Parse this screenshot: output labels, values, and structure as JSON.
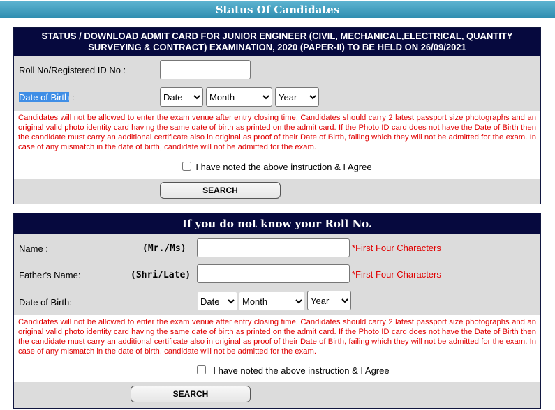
{
  "page_title": "Status Of Candidates",
  "section1": {
    "title": "STATUS / DOWNLOAD ADMIT CARD FOR JUNIOR ENGINEER (CIVIL, MECHANICAL,ELECTRICAL, QUANTITY SURVEYING & CONTRACT) EXAMINATION, 2020 (PAPER-II) TO BE HELD ON 26/09/2021",
    "roll_label": "Roll No/Registered ID No :",
    "roll_value": "",
    "dob_label": "Date of Birth",
    "dob_colon": " :",
    "date": "Date",
    "month": "Month",
    "year": "Year",
    "notice": "Candidates will not be allowed to enter the exam venue after entry closing time. Candidates should carry 2 latest passport size photographs and an original valid photo identity card having the same date of birth as printed on the admit card. If the Photo ID card does not have the Date of Birth then the candidate must carry an additional certificate also in original as proof of their Date of Birth, failing which they will not be admitted for the exam. In case of any mismatch in the date of birth, candidate will not be admitted for the exam.",
    "agree": "I have noted the above instruction & I Agree",
    "search": "SEARCH"
  },
  "section2": {
    "title": "If you do not know your Roll No.",
    "name_label": "Name :",
    "name_prefix": "(Mr./Ms)",
    "name_hint": "*First Four Characters",
    "father_label": "Father's Name:",
    "father_prefix": "(Shri/Late)",
    "father_hint": "*First Four Characters",
    "dob_label": "Date of Birth:",
    "date": "Date",
    "month": "Month",
    "year": "Year",
    "notice": "Candidates will not be allowed to enter the exam venue after entry closing time. Candidates should carry 2 latest passport size photographs and an original valid photo identity card having the same date of birth as printed on the admit card. If the Photo ID card does not have the Date of Birth then the candidate must carry an additional certificate also in original as proof of their Date of Birth, failing which they will not be admitted for the exam. In case of any mismatch in the date of birth, candidate will not be admitted for the exam.",
    "agree": "I have noted the above instruction & I Agree",
    "search": "SEARCH"
  }
}
